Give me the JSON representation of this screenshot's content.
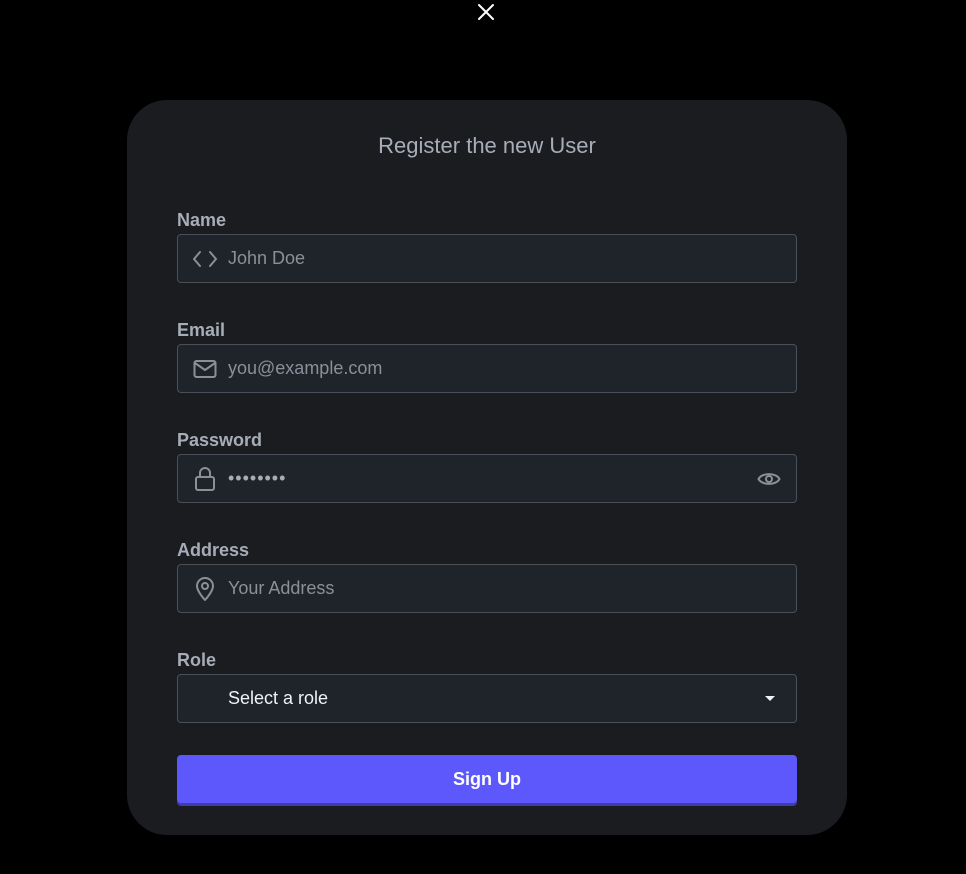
{
  "dialog": {
    "close_icon": "close-icon"
  },
  "form": {
    "title": "Register the new User",
    "name": {
      "label": "Name",
      "placeholder": "John Doe",
      "icon": "code-icon"
    },
    "email": {
      "label": "Email",
      "placeholder": "you@example.com",
      "icon": "mail-icon"
    },
    "password": {
      "label": "Password",
      "masked_value": "••••••••",
      "icon": "lock-icon",
      "toggle_icon": "eye-icon"
    },
    "address": {
      "label": "Address",
      "placeholder": "Your Address",
      "icon": "map-pin-icon"
    },
    "role": {
      "label": "Role",
      "selected": "Select a role"
    },
    "submit_label": "Sign Up"
  },
  "colors": {
    "background": "#000000",
    "card": "#1a1c20",
    "input_bg": "#1f242b",
    "input_border": "#4a5059",
    "label": "#a7adb7",
    "accent": "#5d58fb"
  }
}
